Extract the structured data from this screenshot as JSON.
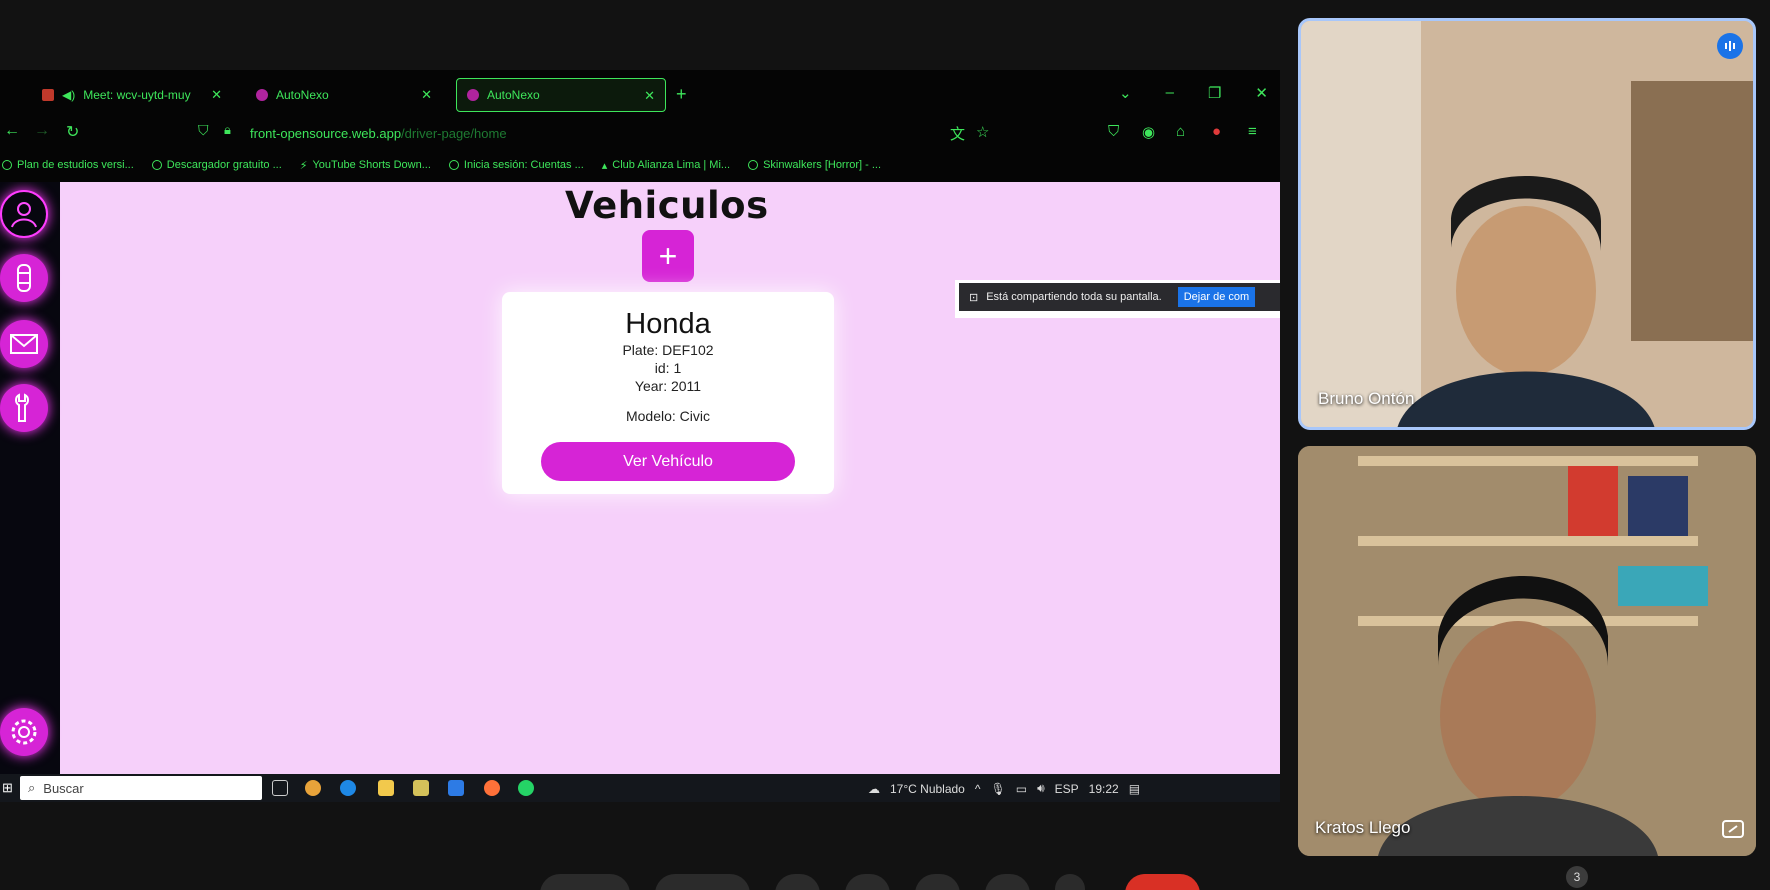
{
  "browser": {
    "tabs": [
      {
        "label": "Meet: wcv-uytd-muy",
        "active": false
      },
      {
        "label": "AutoNexo",
        "active": false
      },
      {
        "label": "AutoNexo",
        "active": true
      }
    ],
    "url_host": "front-opensource.web.app",
    "url_path": "/driver-page/home",
    "bookmarks": [
      "Plan de estudios versi...",
      "Descargador gratuito ...",
      "YouTube Shorts Down...",
      "Inicia sesión: Cuentas ...",
      "Club Alianza Lima | Mi...",
      "Skinwalkers [Horror] - ..."
    ]
  },
  "app": {
    "title": "Vehiculos",
    "add_label": "+",
    "card": {
      "brand": "Honda",
      "plate": "Plate: DEF102",
      "id": "id: 1",
      "year": "Year: 2011",
      "model": "Modelo: Civic",
      "button": "Ver Vehículo"
    },
    "accent": "#d624d6",
    "background": "#f6d0fa"
  },
  "share_notice": {
    "text": "Está compartiendo toda su pantalla.",
    "button": "Dejar de com"
  },
  "taskbar": {
    "search": "Buscar",
    "weather": "17°C  Nublado",
    "lang": "ESP",
    "time": "19:22"
  },
  "meet": {
    "participants": [
      {
        "name": "Bruno Ontón"
      },
      {
        "name": "Kratos Llego"
      }
    ],
    "count": "3"
  }
}
